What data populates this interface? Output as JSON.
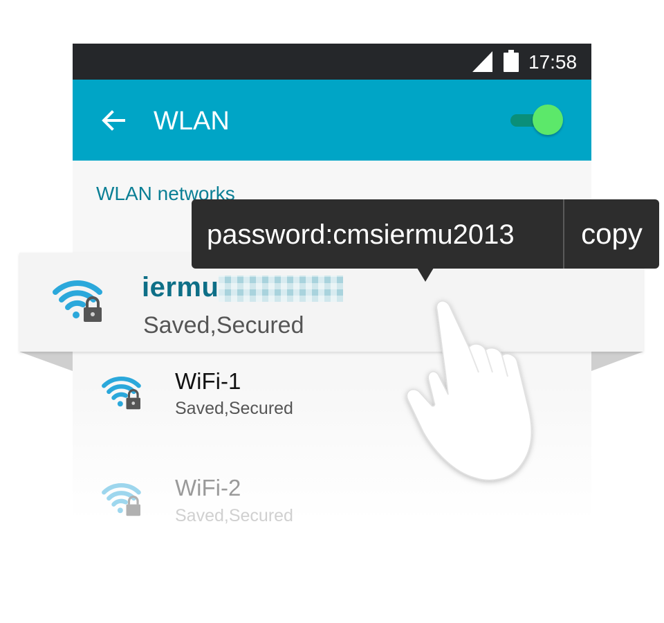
{
  "status_bar": {
    "time": "17:58",
    "icons": [
      "cell-signal-icon",
      "battery-icon"
    ]
  },
  "app_bar": {
    "back_icon": "arrow-left-icon",
    "title": "WLAN",
    "wlan_enabled": true
  },
  "section": {
    "title": "WLAN networks"
  },
  "networks": [
    {
      "ssid": "iermu",
      "ssid_obscured": true,
      "status": "Saved,Secured",
      "icon": "wifi-lock-icon",
      "selected": true
    },
    {
      "ssid": "WiFi-1",
      "status": "Saved,Secured",
      "icon": "wifi-lock-icon"
    },
    {
      "ssid": "WiFi-2",
      "status": "Saved,Secured",
      "icon": "wifi-lock-icon"
    }
  ],
  "tooltip": {
    "text": "password:cmsiermu2013",
    "action": "copy"
  },
  "colors": {
    "status_bar": "#25272a",
    "app_bar": "#00a5c6",
    "toggle_thumb": "#5ce86a",
    "toggle_track": "#0a8f79",
    "section_title": "#0b7f95",
    "ssid_selected": "#0e6f87",
    "wifi_icon": "#2ba8db",
    "tooltip_bg": "#2d2d2d"
  }
}
